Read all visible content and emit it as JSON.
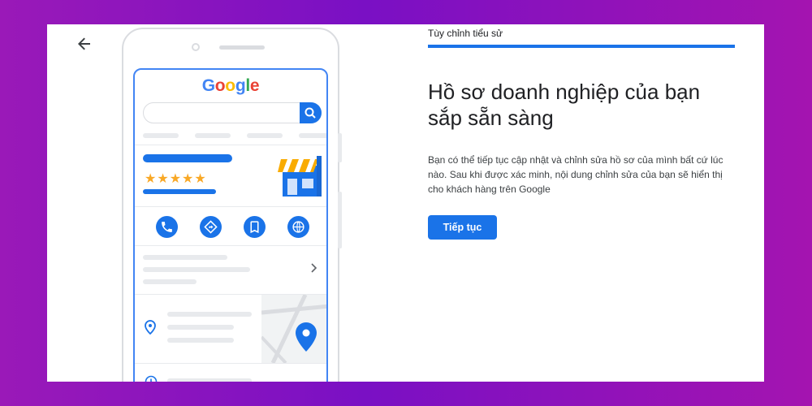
{
  "header": {
    "back_icon": "arrow-left-icon",
    "progress_label": "Tùy chỉnh tiểu sử",
    "progress_value": 1.0
  },
  "main": {
    "title": "Hồ sơ doanh nghiệp của bạn sắp sẵn sàng",
    "description": "Bạn có thể tiếp tục cập nhật và chỉnh sửa hồ sơ của mình bất cứ lúc nào. Sau khi được xác minh, nội dung chỉnh sửa của bạn sẽ hiển thị cho khách hàng trên Google",
    "continue_label": "Tiếp tục"
  },
  "illustration": {
    "logo_text": "Google",
    "rating_stars": 5,
    "stars_text": "★★★★★",
    "action_icons": [
      "phone-icon",
      "directions-icon",
      "bookmark-icon",
      "globe-icon"
    ],
    "pin_icon": "location-pin-icon",
    "clock_icon": "clock-icon"
  },
  "colors": {
    "accent": "#1a73e8",
    "star": "#f9a825",
    "background_left": "#9a19b8",
    "background_right": "#a414b0"
  }
}
